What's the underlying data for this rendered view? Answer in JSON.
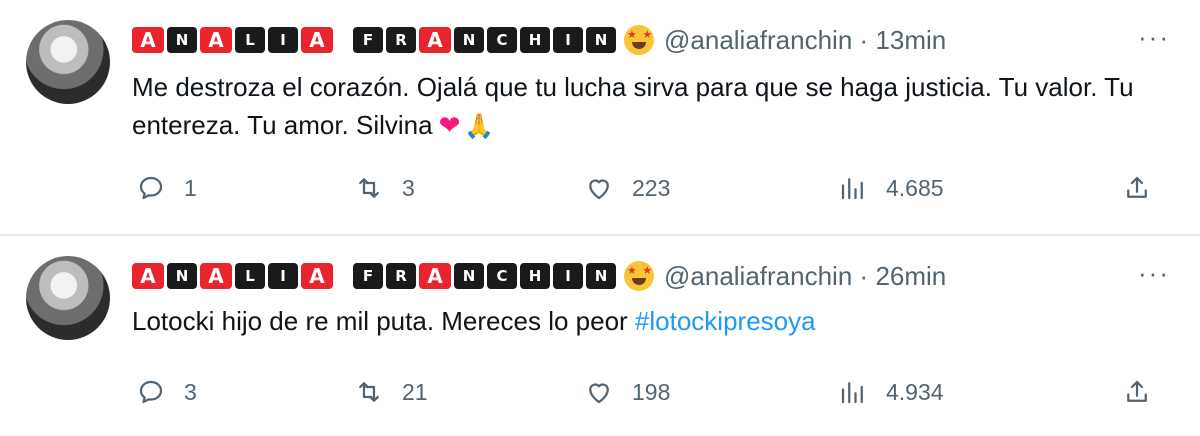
{
  "tweets": [
    {
      "name_tiles": [
        "A",
        "N",
        "A",
        "L",
        "I",
        "A",
        "",
        "F",
        "R",
        "A",
        "N",
        "C",
        "H",
        "I",
        "N"
      ],
      "handle": "@analiafranchin",
      "separator": "·",
      "time": "13min",
      "more": "···",
      "text_main": "Me destroza el corazón. Ojalá que tu lucha sirva para que se haga justicia. Tu valor. Tu entereza. Tu amor. Silvina",
      "emojis": [
        "❤",
        "🙏"
      ],
      "replies": "1",
      "retweets": "3",
      "likes": "223",
      "views": "4.685"
    },
    {
      "name_tiles": [
        "A",
        "N",
        "A",
        "L",
        "I",
        "A",
        "",
        "F",
        "R",
        "A",
        "N",
        "C",
        "H",
        "I",
        "N"
      ],
      "handle": "@analiafranchin",
      "separator": "·",
      "time": "26min",
      "more": "···",
      "text_main": "Lotocki hijo de re mil puta. Mereces lo peor ",
      "hashtag": "#lotockipresoya",
      "replies": "3",
      "retweets": "21",
      "likes": "198",
      "views": "4.934"
    }
  ],
  "colors": {
    "tile_red": "#e8242e",
    "tile_dark": "#1a1a1a",
    "secondary_text": "#536471",
    "hashtag": "#1d9bf0",
    "heart": "#f91880"
  },
  "icons": [
    "reply-icon",
    "retweet-icon",
    "like-icon",
    "views-icon",
    "share-icon",
    "more-icon"
  ]
}
